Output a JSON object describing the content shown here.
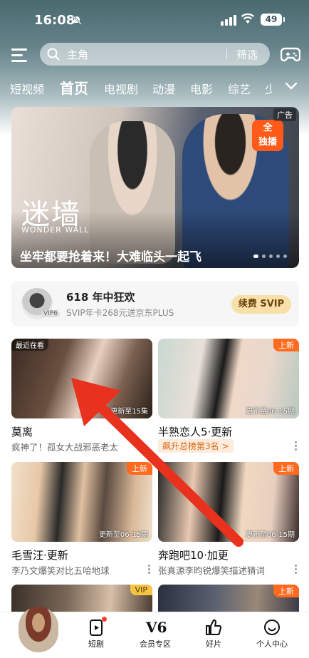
{
  "status": {
    "time": "16:08",
    "battery": "49"
  },
  "search": {
    "placeholder": "主角",
    "filter_label": "筛选"
  },
  "tabs": [
    {
      "label": "短视频"
    },
    {
      "label": "首页"
    },
    {
      "label": "电视剧"
    },
    {
      "label": "动漫"
    },
    {
      "label": "电影"
    },
    {
      "label": "综艺"
    },
    {
      "label": "少"
    }
  ],
  "banner": {
    "logo": "迷墙",
    "logo_sub": "WONDER WALL",
    "caption": "坐牢都要抢着来！大难临头一起飞",
    "ad_label": "广告",
    "promo": "全\n独播"
  },
  "vip": {
    "title": "618 年中狂欢",
    "subtitle": "SVIP年卡268元送京东PLUS",
    "badge": "VIP6",
    "button": "续费 SVIP"
  },
  "cards": [
    {
      "title": "莫离",
      "subtitle": "疯神了！孤女大战邪恶老太",
      "episode": "更新至15集",
      "corner_label": "最近在看"
    },
    {
      "title": "半熟恋人5·更新",
      "rank": "飙升总榜第3名 >",
      "episode": "更新至06-15期",
      "tag": "上新"
    },
    {
      "title": "毛雪汪·更新",
      "subtitle": "李乃文爆笑对比五哈地球",
      "episode": "更新至06-15期",
      "tag": "上新"
    },
    {
      "title": "奔跑吧10·加更",
      "subtitle": "张真源李昀锐爆笑描述猜词",
      "episode": "更新至06-15期",
      "tag": "上新"
    },
    {
      "tag": "VIP"
    },
    {
      "tag": "上新"
    }
  ],
  "bottom_nav": [
    {
      "label": "短剧",
      "icon": "short-drama-icon"
    },
    {
      "label": "会员专区",
      "icon": "v6-icon"
    },
    {
      "label": "好片",
      "icon": "thumbs-up-icon"
    },
    {
      "label": "个人中心",
      "icon": "smile-icon"
    }
  ],
  "colors": {
    "accent": "#ff6a1f",
    "vip_gold": "#f9e0a8",
    "arrow": "#e8321e"
  }
}
